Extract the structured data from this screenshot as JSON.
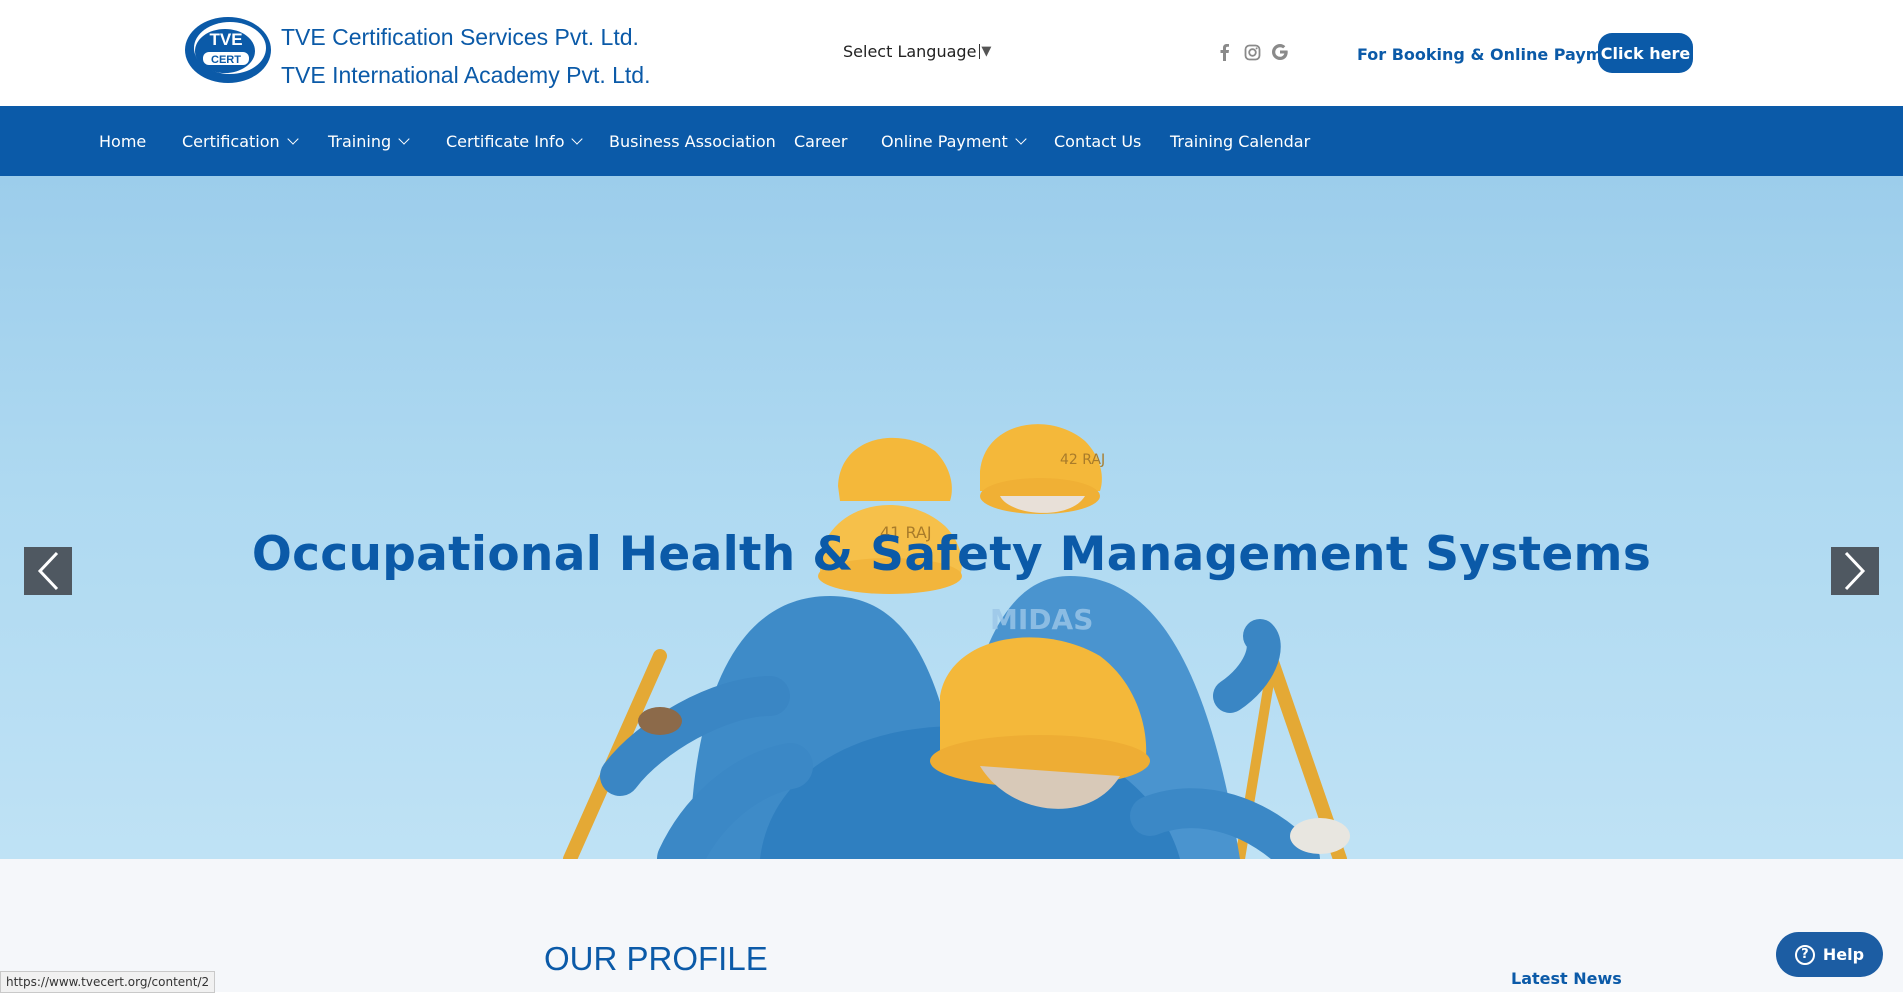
{
  "header": {
    "company_line_1": "TVE Certification Services Pvt. Ltd.",
    "company_line_2": "TVE International Academy Pvt. Ltd.",
    "logo_text_top": "TVE",
    "logo_text_bottom": "CERT",
    "language_label": "Select Language",
    "language_caret": "▼",
    "social_icons": [
      "facebook-icon",
      "instagram-icon",
      "google-icon"
    ],
    "booking_text": "For Booking & Online Payment -",
    "click_here_label": "Click here"
  },
  "nav": {
    "items": [
      {
        "label": "Home",
        "dropdown": false
      },
      {
        "label": "Certification",
        "dropdown": true
      },
      {
        "label": "Training",
        "dropdown": true
      },
      {
        "label": "Certificate Info",
        "dropdown": true
      },
      {
        "label": "Business Association",
        "dropdown": false
      },
      {
        "label": "Career",
        "dropdown": false
      },
      {
        "label": "Online Payment",
        "dropdown": true
      },
      {
        "label": "Contact Us",
        "dropdown": false
      },
      {
        "label": "Training Calendar",
        "dropdown": false
      }
    ]
  },
  "hero": {
    "title": "Occupational Health & Safety Management Systems",
    "helmet_marks": [
      "41 RAJ",
      "42 RAJ",
      "MIDAS"
    ]
  },
  "sections": {
    "profile_title": "OUR PROFILE",
    "news_title": "Latest News"
  },
  "help": {
    "label": "Help",
    "icon": "?"
  },
  "status_bar": {
    "url": "https://www.tvecert.org/content/2"
  },
  "colors": {
    "brand_blue": "#0b5aa8",
    "nav_background": "#0b5aa8",
    "hero_sky": "#aed9f1",
    "helmet_yellow": "#f4b83a",
    "arrow_background": "#4f5861"
  }
}
